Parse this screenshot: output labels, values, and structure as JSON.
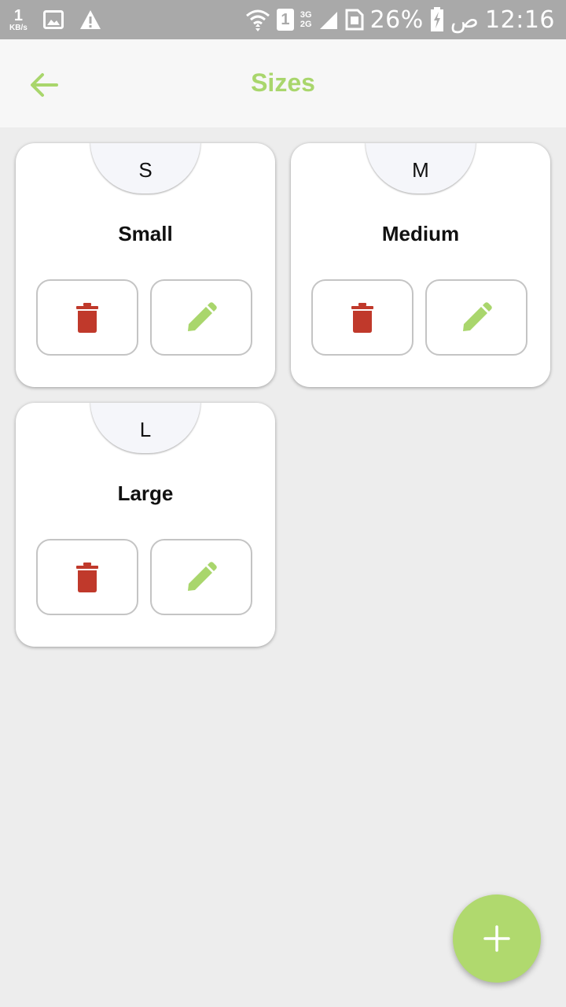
{
  "status_bar": {
    "net_speed_value": "1",
    "net_speed_unit": "KB/s",
    "network_top": "3G",
    "network_bottom": "2G",
    "battery": "26%",
    "time_suffix": "ص",
    "time": "12:16",
    "sim_slot": "1",
    "icons": [
      "image-icon",
      "warning-icon",
      "wifi-icon",
      "sim-icon",
      "signal-icon",
      "sim-card-icon",
      "battery-charging-icon"
    ]
  },
  "app_bar": {
    "title": "Sizes",
    "back_icon": "arrow-left-icon"
  },
  "sizes": [
    {
      "code": "S",
      "name": "Small"
    },
    {
      "code": "M",
      "name": "Medium"
    },
    {
      "code": "L",
      "name": "Large"
    }
  ],
  "fab_icon": "plus-icon",
  "colors": {
    "accent": "#a9d66c",
    "delete": "#c0392b",
    "edit": "#a9d66c",
    "fab": "#b0d96e",
    "status_bar": "#a9a9a9"
  }
}
